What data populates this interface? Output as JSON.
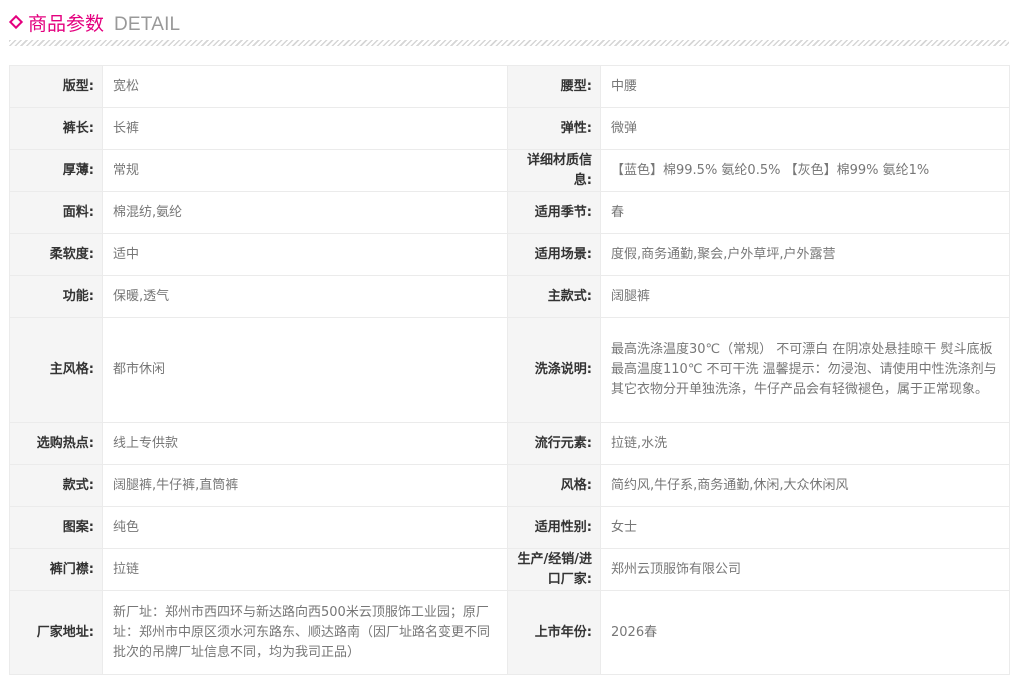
{
  "header": {
    "title_cn": "商品参数",
    "title_en": "DETAIL",
    "accent_color": "#e4007f",
    "icon": "diamond-icon"
  },
  "params": [
    {
      "left_label": "版型:",
      "left_value": "宽松",
      "right_label": "腰型:",
      "right_value": "中腰"
    },
    {
      "left_label": "裤长:",
      "left_value": "长裤",
      "right_label": "弹性:",
      "right_value": "微弹"
    },
    {
      "left_label": "厚薄:",
      "left_value": "常规",
      "right_label": "详细材质信息:",
      "right_value": "【蓝色】棉99.5% 氨纶0.5% 【灰色】棉99% 氨纶1%"
    },
    {
      "left_label": "面料:",
      "left_value": "棉混纺,氨纶",
      "right_label": "适用季节:",
      "right_value": "春"
    },
    {
      "left_label": "柔软度:",
      "left_value": "适中",
      "right_label": "适用场景:",
      "right_value": "度假,商务通勤,聚会,户外草坪,户外露营"
    },
    {
      "left_label": "功能:",
      "left_value": "保暖,透气",
      "right_label": "主款式:",
      "right_value": "阔腿裤"
    },
    {
      "left_label": "主风格:",
      "left_value": "都市休闲",
      "right_label": "洗涤说明:",
      "right_value": "最高洗涤温度30℃（常规） 不可漂白 在阴凉处悬挂晾干 熨斗底板最高温度110℃ 不可干洗 温馨提示：勿浸泡、请使用中性洗涤剂与其它衣物分开单独洗涤，牛仔产品会有轻微褪色，属于正常现象。"
    },
    {
      "left_label": "选购热点:",
      "left_value": "线上专供款",
      "right_label": "流行元素:",
      "right_value": "拉链,水洗"
    },
    {
      "left_label": "款式:",
      "left_value": "阔腿裤,牛仔裤,直筒裤",
      "right_label": "风格:",
      "right_value": "简约风,牛仔系,商务通勤,休闲,大众休闲风"
    },
    {
      "left_label": "图案:",
      "left_value": "纯色",
      "right_label": "适用性别:",
      "right_value": "女士"
    },
    {
      "left_label": "裤门襟:",
      "left_value": "拉链",
      "right_label": "生产/经销/进口厂家:",
      "right_value": "郑州云顶服饰有限公司"
    },
    {
      "left_label": "厂家地址:",
      "left_value": "新厂址：郑州市西四环与新达路向西500米云顶服饰工业园；原厂址：郑州市中原区须水河东路东、顺达路南（因厂址路名变更不同批次的吊牌厂址信息不同，均为我司正品）",
      "right_label": "上市年份:",
      "right_value": "2026春"
    }
  ]
}
